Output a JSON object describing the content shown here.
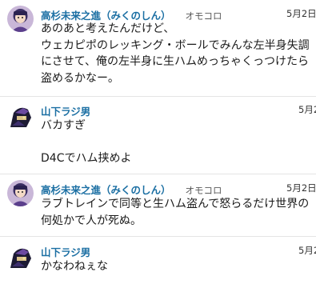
{
  "tweets": [
    {
      "name": "高杉未来之進（みくのしん）",
      "handle": "オモコロ",
      "time": "5月2日",
      "lines": [
        "あのあと考えたんだけど、",
        "ウェカピポのレッキング・ボールでみんな左半身失調",
        "にさせて、俺の左半身に生ハムめっちゃくっつけたら",
        "盗めるかなー。"
      ]
    },
    {
      "name": "山下ラジ男",
      "handle": "",
      "time": "5月2",
      "lines": [
        "バカすぎ",
        "",
        "D4Cでハム挟めよ"
      ]
    },
    {
      "name": "高杉未来之進（みくのしん）",
      "handle": "オモコロ",
      "time": "5月2日",
      "lines": [
        "ラブトレインで同等と生ハム盗んで怒らるだけ世界の",
        "何処かで人が死ぬ。"
      ]
    },
    {
      "name": "山下ラジ男",
      "handle": "",
      "time": "5月2",
      "lines": [
        "かなわねぇな"
      ]
    }
  ]
}
